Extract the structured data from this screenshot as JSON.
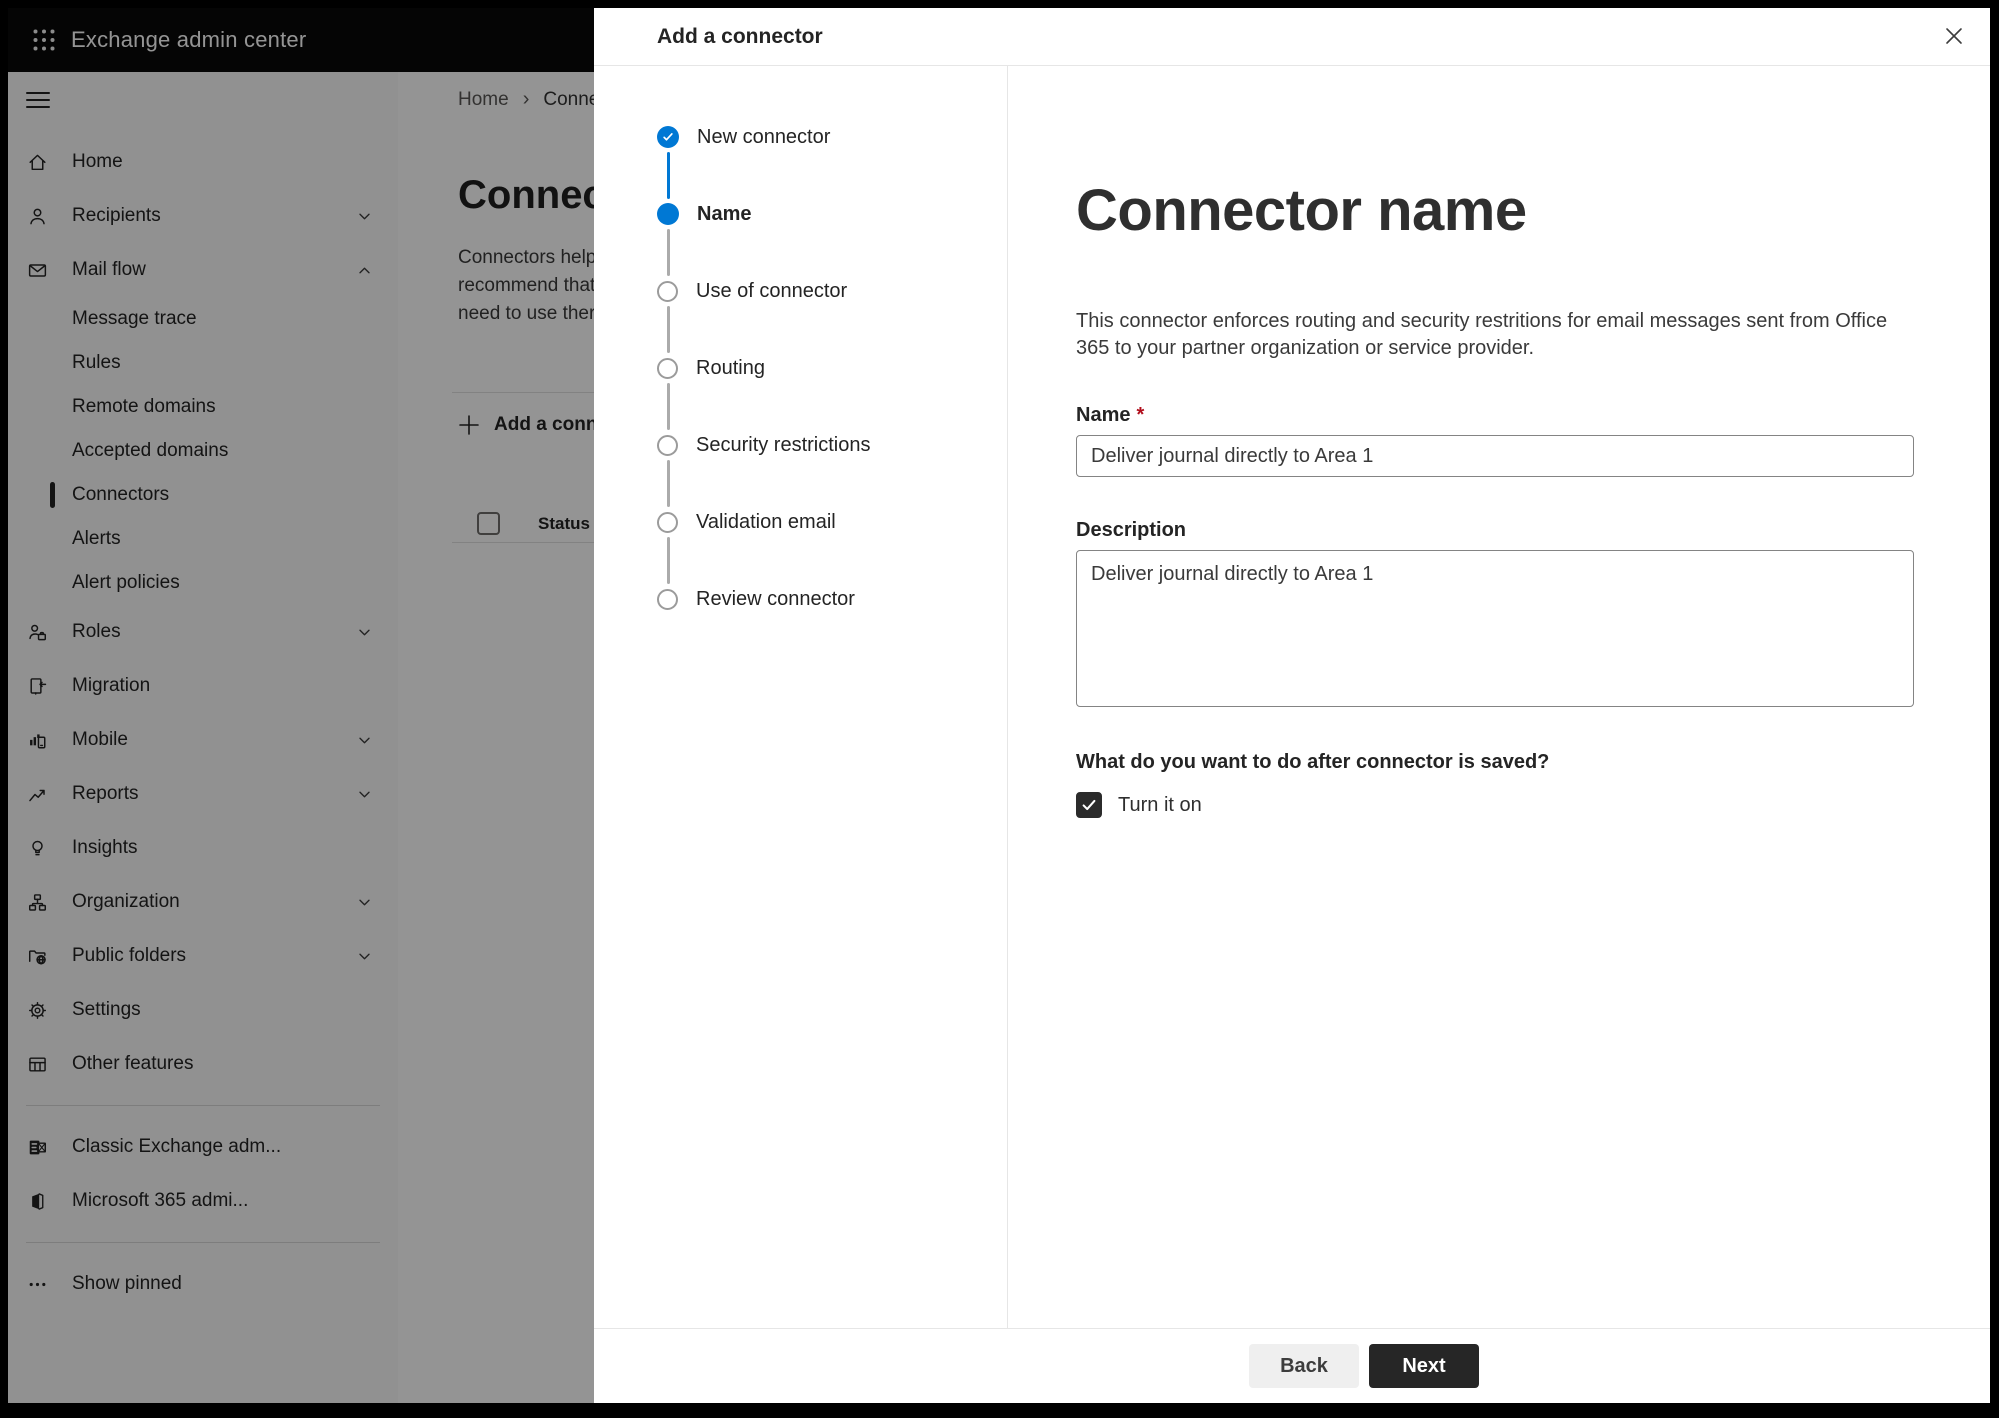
{
  "topbar": {
    "title": "Exchange admin center"
  },
  "sidebar": {
    "items": [
      {
        "label": "Home",
        "icon": "home-icon",
        "kind": "top"
      },
      {
        "label": "Recipients",
        "icon": "person-icon",
        "kind": "top",
        "chevron": "down"
      },
      {
        "label": "Mail flow",
        "icon": "mail-icon",
        "kind": "top",
        "chevron": "up",
        "expanded": true
      },
      {
        "label": "Message trace",
        "kind": "sub"
      },
      {
        "label": "Rules",
        "kind": "sub"
      },
      {
        "label": "Remote domains",
        "kind": "sub"
      },
      {
        "label": "Accepted domains",
        "kind": "sub"
      },
      {
        "label": "Connectors",
        "kind": "sub",
        "selected": true
      },
      {
        "label": "Alerts",
        "kind": "sub"
      },
      {
        "label": "Alert policies",
        "kind": "sub"
      },
      {
        "label": "Roles",
        "icon": "roles-icon",
        "kind": "top",
        "chevron": "down"
      },
      {
        "label": "Migration",
        "icon": "migration-icon",
        "kind": "top"
      },
      {
        "label": "Mobile",
        "icon": "mobile-icon",
        "kind": "top",
        "chevron": "down"
      },
      {
        "label": "Reports",
        "icon": "reports-icon",
        "kind": "top",
        "chevron": "down"
      },
      {
        "label": "Insights",
        "icon": "insights-icon",
        "kind": "top"
      },
      {
        "label": "Organization",
        "icon": "organization-icon",
        "kind": "top",
        "chevron": "down"
      },
      {
        "label": "Public folders",
        "icon": "public-folders-icon",
        "kind": "top",
        "chevron": "down"
      },
      {
        "label": "Settings",
        "icon": "settings-icon",
        "kind": "top"
      },
      {
        "label": "Other features",
        "icon": "other-features-icon",
        "kind": "top"
      },
      {
        "divider": true
      },
      {
        "label": "Classic Exchange adm...",
        "icon": "classic-exchange-icon",
        "kind": "top"
      },
      {
        "label": "Microsoft 365 admi...",
        "icon": "microsoft-365-icon",
        "kind": "top"
      },
      {
        "divider": true
      },
      {
        "label": "Show pinned",
        "icon": "ellipsis-icon",
        "kind": "top"
      }
    ]
  },
  "page": {
    "breadcrumb": {
      "home": "Home",
      "separator": "›",
      "current": "Connectors"
    },
    "title": "Connectors",
    "intro_lines": [
      "Connectors help",
      "recommend that",
      "need to use ther"
    ],
    "add_button_label": "Add a connector",
    "table": {
      "status_header": "Status"
    }
  },
  "dialog": {
    "title": "Add a connector",
    "steps": [
      {
        "label": "New connector",
        "state": "completed"
      },
      {
        "label": "Name",
        "state": "current"
      },
      {
        "label": "Use of connector",
        "state": "upcoming"
      },
      {
        "label": "Routing",
        "state": "upcoming"
      },
      {
        "label": "Security restrictions",
        "state": "upcoming"
      },
      {
        "label": "Validation email",
        "state": "upcoming"
      },
      {
        "label": "Review connector",
        "state": "upcoming"
      }
    ],
    "panel": {
      "heading": "Connector name",
      "description": "This connector enforces routing and security restritions for email messages sent from Office 365 to your partner organization or service provider.",
      "name_label": "Name",
      "required_marker": "*",
      "name_value": "Deliver journal directly to Area 1",
      "description_label": "Description",
      "description_value": "Deliver journal directly to Area 1",
      "question": "What do you want to do after connector is saved?",
      "turn_on_label": "Turn it on",
      "turn_on_checked": true
    },
    "footer": {
      "back": "Back",
      "next": "Next"
    }
  },
  "colors": {
    "accent": "#0078d4",
    "topbar_bg": "#0a0a0a",
    "selected_indicator": "#242424",
    "primary_button_bg": "#262626",
    "required_red": "#b10e1c",
    "overlay_scrim": "rgba(0,0,0,0.42)"
  }
}
